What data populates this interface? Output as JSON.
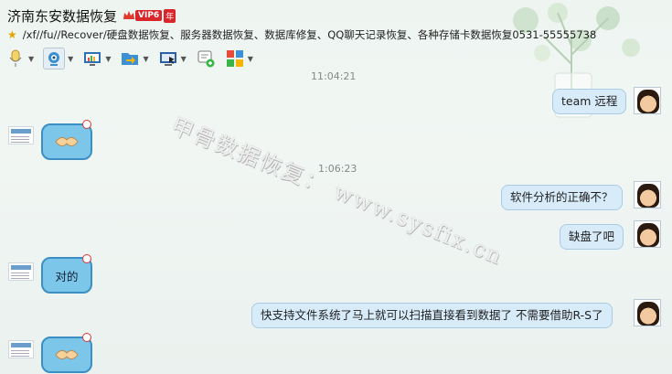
{
  "header": {
    "title": "济南东安数据恢复",
    "vip_badge": "VIP6",
    "vip_year": "年",
    "signature": "/xf//fu//Recover/硬盘数据恢复、服务器数据恢复、数据库修复、QQ聊天记录恢复、各种存储卡数据恢复0531-55555738"
  },
  "toolbar": {
    "icons": [
      "microphone-icon",
      "camera-icon",
      "screen-share-icon",
      "send-file-icon",
      "remote-desktop-icon",
      "message-add-icon",
      "apps-icon"
    ]
  },
  "chat": {
    "time_top": "11:04:21",
    "time_mid": "1:06:23",
    "messages": [
      {
        "side": "right",
        "text": "team 远程"
      },
      {
        "side": "left",
        "text": ""
      },
      {
        "side": "right",
        "text": "软件分析的正确不？"
      },
      {
        "side": "right",
        "text": "缺盘了吧"
      },
      {
        "side": "left",
        "text": "对的"
      },
      {
        "side": "right",
        "text": "快支持文件系统了马上就可以扫描直接看到数据了 不需要借助R-S了"
      },
      {
        "side": "left",
        "text": ""
      }
    ]
  },
  "watermark": "甲骨数据恢复： www.sysfix.cn",
  "colors": {
    "bubble": "#d7ebf9",
    "bubble_border": "#a9cbe6",
    "vip": "#d8262a",
    "accent": "#3c8fc4"
  }
}
